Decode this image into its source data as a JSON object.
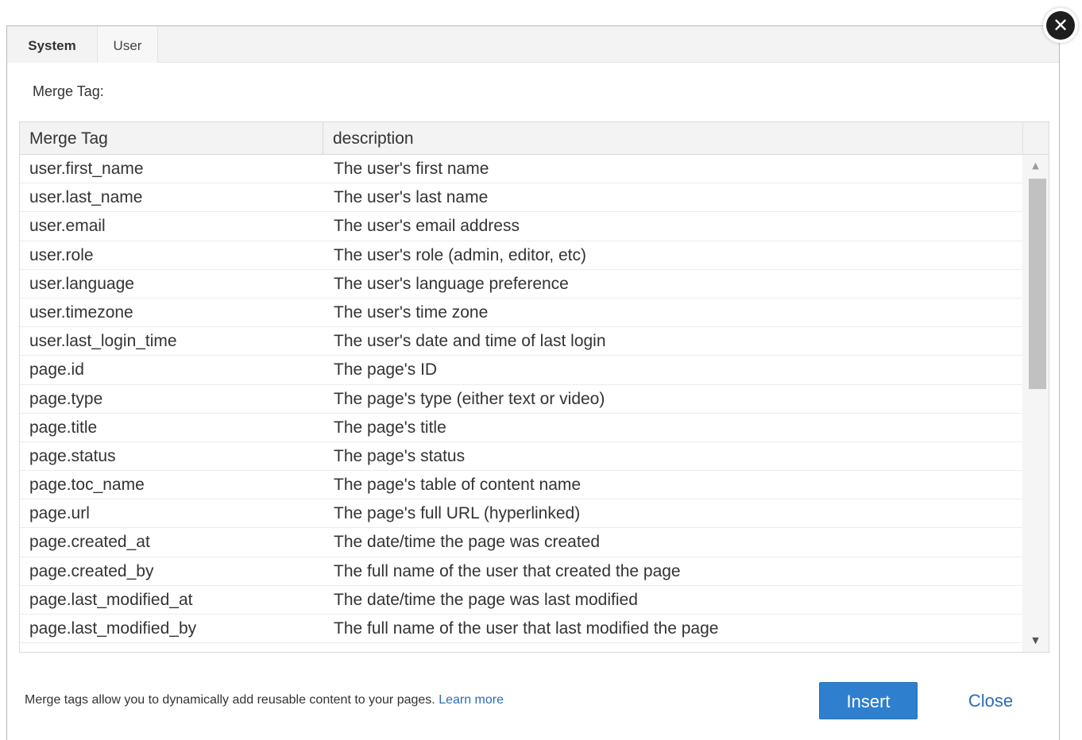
{
  "tabs": [
    {
      "label": "System",
      "active": true
    },
    {
      "label": "User",
      "active": false
    }
  ],
  "merge_tag_label": "Merge Tag:",
  "table": {
    "columns": [
      "Merge Tag",
      "description"
    ],
    "rows": [
      {
        "tag": "user.first_name",
        "description": "The user's first name"
      },
      {
        "tag": "user.last_name",
        "description": "The user's last name"
      },
      {
        "tag": "user.email",
        "description": "The user's email address"
      },
      {
        "tag": "user.role",
        "description": "The user's role (admin, editor, etc)"
      },
      {
        "tag": "user.language",
        "description": "The user's language preference"
      },
      {
        "tag": "user.timezone",
        "description": "The user's time zone"
      },
      {
        "tag": "user.last_login_time",
        "description": "The user's date and time of last login"
      },
      {
        "tag": "page.id",
        "description": "The page's ID"
      },
      {
        "tag": "page.type",
        "description": "The page's type (either text or video)"
      },
      {
        "tag": "page.title",
        "description": "The page's title"
      },
      {
        "tag": "page.status",
        "description": "The page's status"
      },
      {
        "tag": "page.toc_name",
        "description": "The page's table of content name"
      },
      {
        "tag": "page.url",
        "description": "The page's full URL (hyperlinked)"
      },
      {
        "tag": "page.created_at",
        "description": "The date/time the page was created"
      },
      {
        "tag": "page.created_by",
        "description": "The full name of the user that created the page"
      },
      {
        "tag": "page.last_modified_at",
        "description": "The date/time the page was last modified"
      },
      {
        "tag": "page.last_modified_by",
        "description": "The full name of the user that last modified the page"
      }
    ]
  },
  "footer": {
    "text": "Merge tags allow you to dynamically add reusable content to your pages. ",
    "learn_more": "Learn more"
  },
  "buttons": {
    "insert": "Insert",
    "close": "Close"
  },
  "icons": {
    "dialog_close": "close-icon",
    "scroll_up": "arrow-up-icon",
    "scroll_down": "arrow-down-icon"
  },
  "colors": {
    "accent": "#2f7fcf",
    "link": "#2b6cb5",
    "header_bg": "#f3f3f3"
  }
}
